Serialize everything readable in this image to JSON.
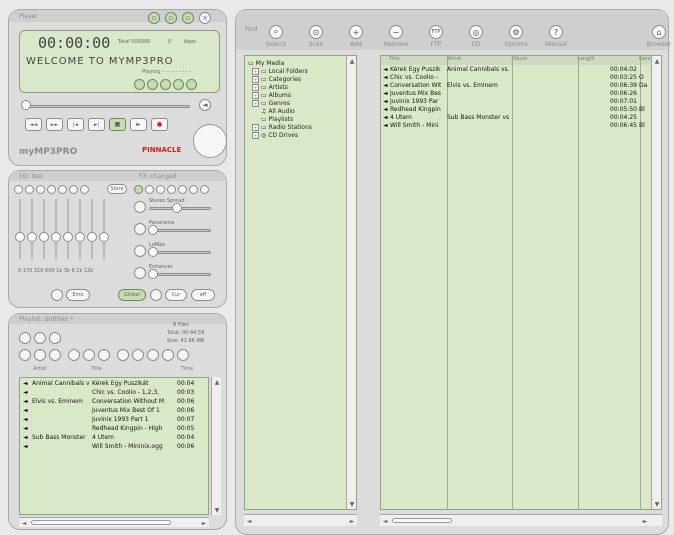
{
  "player": {
    "title": "Player",
    "time": "00:00:00",
    "total_label": "Total 000000",
    "zero_label": "0",
    "kbps_label": "kbps",
    "marquee": "WELCOME  TO  MYMP3PRO",
    "status": "Playing - - - - - - - - -",
    "brand": "myMP3PRO",
    "pinnacle": "PINNACLE"
  },
  "eq": {
    "title": "EQ: test",
    "store_label": "Store",
    "right_title": "FX: changed",
    "fx_items": [
      "Stereo Spread",
      "Panorama",
      "LoMax",
      "Enhancer"
    ],
    "freqs": "0  170 310 600 1k  3k 6.1k 12k",
    "bottom_buttons": [
      "Emo",
      "Global",
      "Cur",
      "off"
    ]
  },
  "playlist": {
    "title": "Playlist: Untitled *",
    "files": "8  Files",
    "total": "Total:  00:44:58",
    "size": "Size:  41.66   MB",
    "columns": [
      "Artist",
      "Title",
      "Time"
    ],
    "rows": [
      {
        "artist": "Animal Cannibals v",
        "title": "Kérek Egy Puszikát",
        "time": "00:04"
      },
      {
        "artist": "",
        "title": "Chic vs. Coolio - 1,2,3,",
        "time": "00:03"
      },
      {
        "artist": "Elvis vs. Eminem",
        "title": "Conversation Without M",
        "time": "00:06"
      },
      {
        "artist": "",
        "title": "Juventus Mix Best Of 1",
        "time": "00:06"
      },
      {
        "artist": "",
        "title": "Juvinix 1993 Part 1",
        "time": "00:07"
      },
      {
        "artist": "",
        "title": "Redhead Kingpin - High",
        "time": "00:05"
      },
      {
        "artist": "Sub Bass Monster",
        "title": "4 Ütem",
        "time": "00:04"
      },
      {
        "artist": "",
        "title": "Will Smith - Mininix.ogg",
        "time": "00:06"
      }
    ]
  },
  "toolbar": {
    "title": "Find",
    "items": [
      "Search",
      "Scan",
      "Add",
      "Remove",
      "FTP",
      "CD",
      "Options",
      "Manual",
      "Browser"
    ]
  },
  "tree": {
    "items": [
      "My Media",
      "Local Folders",
      "Categories",
      "Artists",
      "Albums",
      "Genres",
      "All Audio",
      "Playlists",
      "Radio Stations",
      "CD Drives"
    ]
  },
  "media": {
    "columns": [
      "Title",
      "Artist",
      "Album",
      "Length",
      "Genre"
    ],
    "rows": [
      {
        "title": "Kérek Egy Puszik",
        "artist": "Animal Cannibals vs.",
        "album": "",
        "length": "00:04:02",
        "genre": ""
      },
      {
        "title": "Chic vs. Coolio -",
        "artist": "",
        "album": "",
        "length": "00:03:25",
        "genre": "O"
      },
      {
        "title": "Conversation Wit",
        "artist": "Elvis vs. Eminem",
        "album": "",
        "length": "00:06:39",
        "genre": "Da"
      },
      {
        "title": "Juventus Mix Bes",
        "artist": "",
        "album": "",
        "length": "00:06:26",
        "genre": ""
      },
      {
        "title": "Juvinix 1993 Par",
        "artist": "",
        "album": "",
        "length": "00:07:01",
        "genre": ""
      },
      {
        "title": "Redhead Kingpin",
        "artist": "",
        "album": "",
        "length": "00:05:50",
        "genre": "Bl"
      },
      {
        "title": "4 Ütem",
        "artist": "Sub Bass Monster vs",
        "album": "",
        "length": "00:04:25",
        "genre": ""
      },
      {
        "title": "Will Smith - Mini",
        "artist": "",
        "album": "",
        "length": "00:06:45",
        "genre": "Bl"
      }
    ]
  },
  "colors": {
    "lcd_green": "#d8e8c8",
    "panel_gray": "#dcdcdc",
    "accent_red": "#d11e1e"
  }
}
